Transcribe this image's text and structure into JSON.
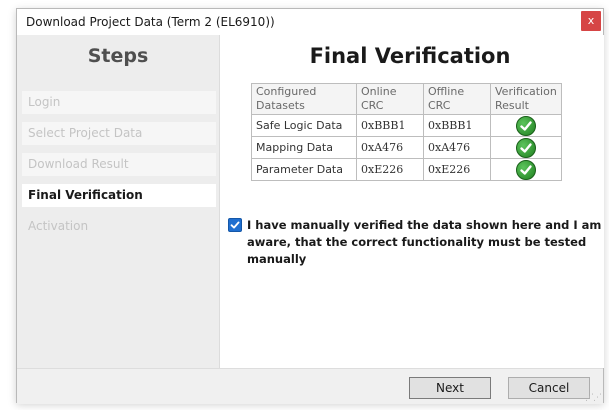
{
  "window": {
    "title": "Download Project Data (Term 2 (EL6910))",
    "close_glyph": "x"
  },
  "sidebar": {
    "title": "Steps",
    "items": [
      {
        "label": "Login",
        "state": "done"
      },
      {
        "label": "Select Project Data",
        "state": "done"
      },
      {
        "label": "Download Result",
        "state": "done"
      },
      {
        "label": "Final Verification",
        "state": "active"
      },
      {
        "label": "Activation",
        "state": "pending"
      }
    ]
  },
  "main": {
    "title": "Final Verification",
    "table": {
      "headers": {
        "configured_1": "Configured",
        "configured_2": "Datasets",
        "online_1": "Online",
        "online_2": "CRC",
        "offline_1": "Offline",
        "offline_2": "CRC",
        "verif_1": "Verification",
        "verif_2": "Result"
      },
      "rows": [
        {
          "dataset": "Safe Logic Data",
          "online": "0xBBB1",
          "offline": "0xBBB1",
          "result_icon": "check-circle-icon"
        },
        {
          "dataset": "Mapping Data",
          "online": "0xA476",
          "offline": "0xA476",
          "result_icon": "check-circle-icon"
        },
        {
          "dataset": "Parameter Data",
          "online": "0xE226",
          "offline": "0xE226",
          "result_icon": "check-circle-icon"
        }
      ]
    },
    "confirm": {
      "checked": true,
      "text": "I have manually verified the data shown here and I am aware, that the correct functionality must be tested manually"
    }
  },
  "footer": {
    "next_label": "Next",
    "cancel_label": "Cancel"
  },
  "colors": {
    "accent": "#1f6fd0",
    "close": "#d64545",
    "check": "#2f9a2f"
  }
}
